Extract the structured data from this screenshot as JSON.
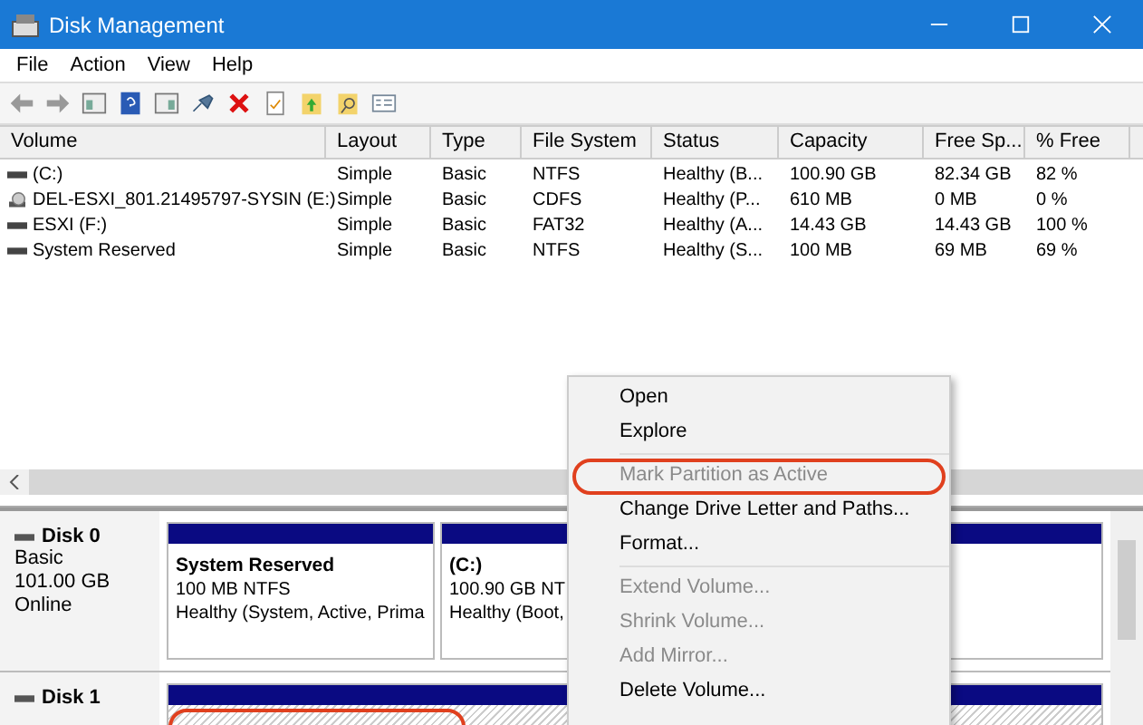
{
  "window": {
    "title": "Disk Management"
  },
  "menu": [
    "File",
    "Action",
    "View",
    "Help"
  ],
  "table": {
    "columns": [
      "Volume",
      "Layout",
      "Type",
      "File System",
      "Status",
      "Capacity",
      "Free Sp...",
      "% Free"
    ],
    "rows": [
      {
        "kind": "disk",
        "cells": [
          "(C:)",
          "Simple",
          "Basic",
          "NTFS",
          "Healthy (B...",
          "100.90 GB",
          "82.34 GB",
          "82 %"
        ]
      },
      {
        "kind": "cd",
        "cells": [
          "DEL-ESXI_801.21495797-SYSIN (E:)",
          "Simple",
          "Basic",
          "CDFS",
          "Healthy (P...",
          "610 MB",
          "0 MB",
          "0 %"
        ]
      },
      {
        "kind": "disk",
        "cells": [
          "ESXI (F:)",
          "Simple",
          "Basic",
          "FAT32",
          "Healthy (A...",
          "14.43 GB",
          "14.43 GB",
          "100 %"
        ]
      },
      {
        "kind": "disk",
        "cells": [
          "System Reserved",
          "Simple",
          "Basic",
          "NTFS",
          "Healthy (S...",
          "100 MB",
          "69 MB",
          "69 %"
        ]
      }
    ]
  },
  "disks": [
    {
      "name": "Disk 0",
      "info": [
        "Basic",
        "101.00 GB",
        "Online"
      ],
      "partitions": [
        {
          "name": "System Reserved",
          "lines": [
            "100 MB NTFS",
            "Healthy (System, Active, Prima"
          ],
          "highlighted": false
        },
        {
          "name": "(C:)",
          "lines": [
            "100.90 GB NT",
            "Healthy (Boot,"
          ],
          "highlighted": false
        }
      ]
    },
    {
      "name": "Disk 1",
      "partitions": [
        {
          "highlighted": true
        }
      ]
    }
  ],
  "context_menu": {
    "groups": [
      [
        {
          "label": "Open",
          "disabled": false,
          "highlighted": false
        },
        {
          "label": "Explore",
          "disabled": false,
          "highlighted": false
        }
      ],
      [
        {
          "label": "Mark Partition as Active",
          "disabled": true,
          "highlighted": true
        },
        {
          "label": "Change Drive Letter and Paths...",
          "disabled": false,
          "highlighted": false
        },
        {
          "label": "Format...",
          "disabled": false,
          "highlighted": false
        }
      ],
      [
        {
          "label": "Extend Volume...",
          "disabled": true,
          "highlighted": false
        },
        {
          "label": "Shrink Volume...",
          "disabled": true,
          "highlighted": false
        },
        {
          "label": "Add Mirror...",
          "disabled": true,
          "highlighted": false
        },
        {
          "label": "Delete Volume...",
          "disabled": false,
          "highlighted": false
        }
      ]
    ]
  }
}
